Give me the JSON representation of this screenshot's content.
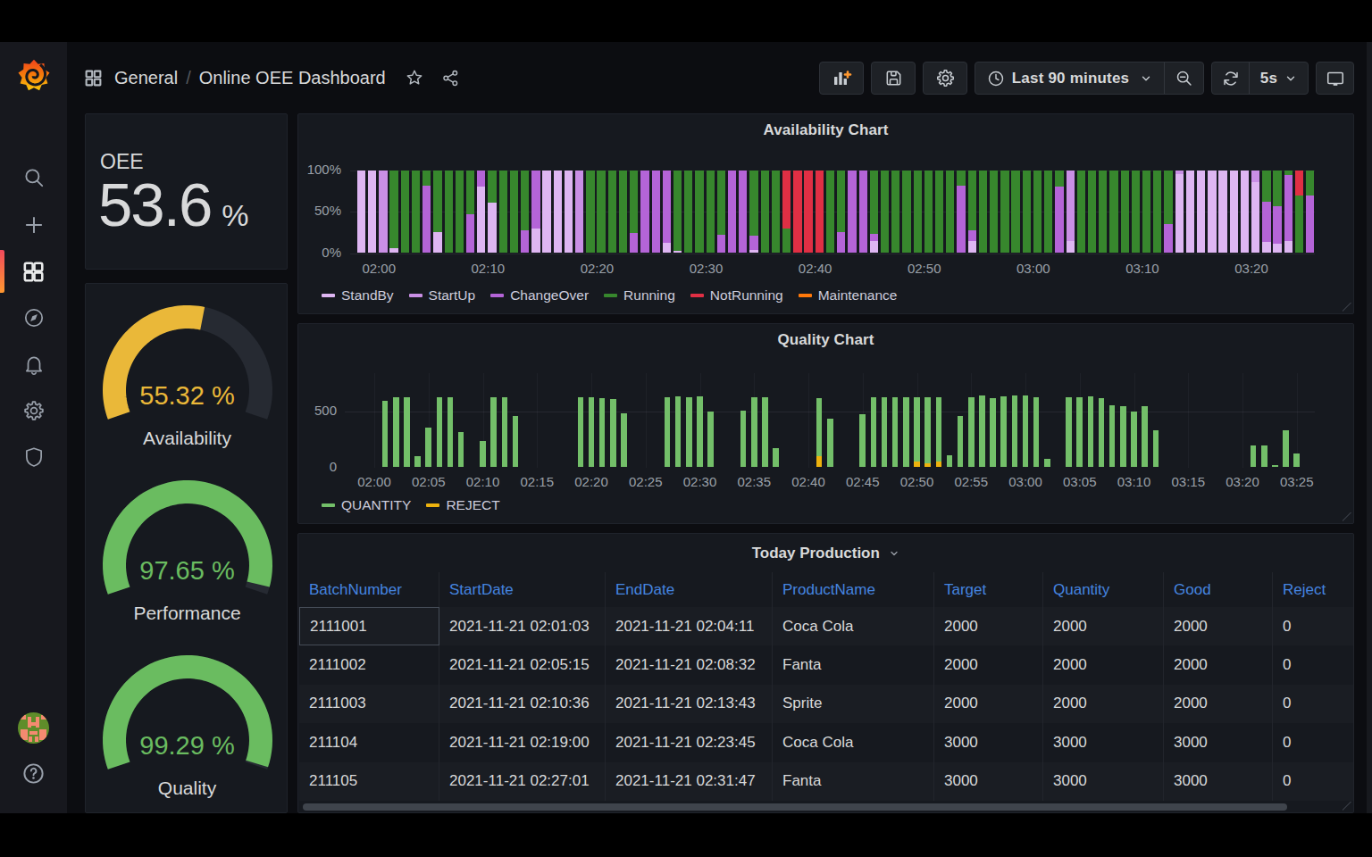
{
  "colors": {
    "standby": "#DEB6F2",
    "startup": "#C98FE5",
    "changeover": "#B464D7",
    "running": "#37872D",
    "notrunning": "#E02F44",
    "maintenance": "#FF780A",
    "quantity": "#73BF69",
    "reject": "#EDB20E",
    "gauge_yellow": "#EAB839",
    "gauge_green": "#73BF69",
    "gauge_track": "#262a32",
    "table_header_blue": "#4585e0"
  },
  "sidebar": {
    "icons": [
      "grafana-logo",
      "search",
      "plus",
      "apps",
      "compass",
      "bell",
      "gear",
      "shield"
    ],
    "avatar": "user-avatar",
    "help": "question-circle"
  },
  "header": {
    "breadcrumb_root": "General",
    "breadcrumb_sep": "/",
    "breadcrumb_current": "Online OEE Dashboard",
    "time_range_label": "Last 90 minutes",
    "refresh_interval_label": "5s"
  },
  "oee": {
    "title": "OEE",
    "value": "53.6",
    "unit": "%"
  },
  "gauges": [
    {
      "label": "Availability",
      "value_text": "55.32 %",
      "percent": 55.32,
      "color": "#EAB839"
    },
    {
      "label": "Performance",
      "value_text": "97.65 %",
      "percent": 97.65,
      "color": "#6ABC60"
    },
    {
      "label": "Quality",
      "value_text": "99.29 %",
      "percent": 99.29,
      "color": "#6ABC60"
    }
  ],
  "chart_data": [
    {
      "type": "bar",
      "title": "Availability Chart",
      "stacked": true,
      "unit": "percent",
      "ylim": [
        0,
        100
      ],
      "yticks": [
        "0%",
        "50%",
        "100%"
      ],
      "xticks": [
        "02:00",
        "02:10",
        "02:20",
        "02:30",
        "02:40",
        "02:50",
        "03:00",
        "03:10",
        "03:20"
      ],
      "legend": [
        {
          "name": "StandBy",
          "color_key": "standby"
        },
        {
          "name": "StartUp",
          "color_key": "startup"
        },
        {
          "name": "ChangeOver",
          "color_key": "changeover"
        },
        {
          "name": "Running",
          "color_key": "running"
        },
        {
          "name": "NotRunning",
          "color_key": "notrunning"
        },
        {
          "name": "Maintenance",
          "color_key": "maintenance"
        }
      ],
      "start_time": "01:58",
      "bars": [
        [
          [
            "standby",
            100
          ]
        ],
        [
          [
            "standby",
            100
          ]
        ],
        [
          [
            "startup",
            100
          ]
        ],
        [
          [
            "standby",
            6
          ],
          [
            "running",
            94
          ]
        ],
        [
          [
            "running",
            100
          ]
        ],
        [
          [
            "running",
            100
          ]
        ],
        [
          [
            "changeover",
            81
          ],
          [
            "running",
            19
          ]
        ],
        [
          [
            "standby",
            25
          ],
          [
            "running",
            75
          ]
        ],
        [
          [
            "running",
            100
          ]
        ],
        [
          [
            "running",
            100
          ]
        ],
        [
          [
            "changeover",
            47
          ],
          [
            "running",
            53
          ]
        ],
        [
          [
            "standby",
            80
          ],
          [
            "changeover",
            20
          ]
        ],
        [
          [
            "standby",
            61
          ],
          [
            "running",
            39
          ]
        ],
        [
          [
            "running",
            100
          ]
        ],
        [
          [
            "running",
            100
          ]
        ],
        [
          [
            "changeover",
            27
          ],
          [
            "running",
            73
          ]
        ],
        [
          [
            "standby",
            30
          ],
          [
            "changeover",
            70
          ]
        ],
        [
          [
            "standby",
            100
          ]
        ],
        [
          [
            "standby",
            100
          ]
        ],
        [
          [
            "standby",
            100
          ]
        ],
        [
          [
            "startup",
            100
          ]
        ],
        [
          [
            "running",
            100
          ]
        ],
        [
          [
            "running",
            100
          ]
        ],
        [
          [
            "running",
            100
          ]
        ],
        [
          [
            "running",
            100
          ]
        ],
        [
          [
            "changeover",
            24
          ],
          [
            "running",
            76
          ]
        ],
        [
          [
            "changeover",
            100
          ]
        ],
        [
          [
            "changeover",
            100
          ]
        ],
        [
          [
            "standby",
            12
          ],
          [
            "changeover",
            88
          ]
        ],
        [
          [
            "standby",
            3
          ],
          [
            "running",
            97
          ]
        ],
        [
          [
            "running",
            100
          ]
        ],
        [
          [
            "running",
            100
          ]
        ],
        [
          [
            "running",
            100
          ]
        ],
        [
          [
            "changeover",
            22
          ],
          [
            "running",
            78
          ]
        ],
        [
          [
            "changeover",
            100
          ]
        ],
        [
          [
            "changeover",
            100
          ]
        ],
        [
          [
            "standby",
            4
          ],
          [
            "changeover",
            17
          ],
          [
            "running",
            79
          ]
        ],
        [
          [
            "running",
            100
          ]
        ],
        [
          [
            "running",
            100
          ]
        ],
        [
          [
            "running",
            30
          ],
          [
            "notrunning",
            70
          ]
        ],
        [
          [
            "notrunning",
            100
          ]
        ],
        [
          [
            "notrunning",
            100
          ]
        ],
        [
          [
            "notrunning",
            100
          ]
        ],
        [
          [
            "running",
            100
          ]
        ],
        [
          [
            "changeover",
            25
          ],
          [
            "running",
            75
          ]
        ],
        [
          [
            "changeover",
            100
          ]
        ],
        [
          [
            "changeover",
            100
          ]
        ],
        [
          [
            "standby",
            15
          ],
          [
            "changeover",
            8
          ],
          [
            "running",
            77
          ]
        ],
        [
          [
            "running",
            100
          ]
        ],
        [
          [
            "running",
            100
          ]
        ],
        [
          [
            "running",
            100
          ]
        ],
        [
          [
            "running",
            100
          ]
        ],
        [
          [
            "running",
            100
          ]
        ],
        [
          [
            "running",
            100
          ]
        ],
        [
          [
            "running",
            100
          ]
        ],
        [
          [
            "changeover",
            81
          ],
          [
            "running",
            19
          ]
        ],
        [
          [
            "standby",
            15
          ],
          [
            "changeover",
            13
          ],
          [
            "running",
            72
          ]
        ],
        [
          [
            "running",
            100
          ]
        ],
        [
          [
            "running",
            100
          ]
        ],
        [
          [
            "running",
            100
          ]
        ],
        [
          [
            "running",
            100
          ]
        ],
        [
          [
            "running",
            100
          ]
        ],
        [
          [
            "running",
            100
          ]
        ],
        [
          [
            "running",
            100
          ]
        ],
        [
          [
            "changeover",
            80
          ],
          [
            "running",
            20
          ]
        ],
        [
          [
            "standby",
            15
          ],
          [
            "startup",
            85
          ]
        ],
        [
          [
            "running",
            100
          ]
        ],
        [
          [
            "running",
            100
          ]
        ],
        [
          [
            "running",
            100
          ]
        ],
        [
          [
            "running",
            100
          ]
        ],
        [
          [
            "running",
            100
          ]
        ],
        [
          [
            "running",
            100
          ]
        ],
        [
          [
            "running",
            100
          ]
        ],
        [
          [
            "running",
            100
          ]
        ],
        [
          [
            "changeover",
            35
          ],
          [
            "running",
            65
          ]
        ],
        [
          [
            "standby",
            96
          ],
          [
            "startup",
            4
          ]
        ],
        [
          [
            "standby",
            100
          ]
        ],
        [
          [
            "standby",
            100
          ]
        ],
        [
          [
            "standby",
            100
          ]
        ],
        [
          [
            "standby",
            100
          ]
        ],
        [
          [
            "standby",
            100
          ]
        ],
        [
          [
            "standby",
            100
          ]
        ],
        [
          [
            "standby",
            86
          ],
          [
            "startup",
            14
          ]
        ],
        [
          [
            "standby",
            13
          ],
          [
            "changeover",
            49
          ],
          [
            "running",
            38
          ]
        ],
        [
          [
            "standby",
            11
          ],
          [
            "changeover",
            46
          ],
          [
            "running",
            43
          ]
        ],
        [
          [
            "standby",
            15
          ],
          [
            "changeover",
            79
          ],
          [
            "running",
            6
          ]
        ],
        [
          [
            "running",
            70
          ],
          [
            "notrunning",
            30
          ]
        ],
        [
          [
            "changeover",
            70
          ],
          [
            "running",
            30
          ]
        ]
      ]
    },
    {
      "type": "bar",
      "title": "Quality Chart",
      "stacked": true,
      "ylim": [
        0,
        715
      ],
      "yticks": [
        "0",
        "500"
      ],
      "xticks": [
        "02:00",
        "02:05",
        "02:10",
        "02:15",
        "02:20",
        "02:25",
        "02:30",
        "02:35",
        "02:40",
        "02:45",
        "02:50",
        "02:55",
        "03:00",
        "03:05",
        "03:10",
        "03:15",
        "03:20",
        "03:25"
      ],
      "legend": [
        {
          "name": "QUANTITY",
          "color_key": "quantity"
        },
        {
          "name": "REJECT",
          "color_key": "reject"
        }
      ],
      "bars": [
        {
          "m": 1,
          "quantity": 600,
          "reject": 0
        },
        {
          "m": 2,
          "quantity": 635,
          "reject": 0
        },
        {
          "m": 3,
          "quantity": 630,
          "reject": 0
        },
        {
          "m": 4,
          "quantity": 100,
          "reject": 0
        },
        {
          "m": 5,
          "quantity": 360,
          "reject": 0
        },
        {
          "m": 6,
          "quantity": 635,
          "reject": 0
        },
        {
          "m": 7,
          "quantity": 635,
          "reject": 0
        },
        {
          "m": 8,
          "quantity": 320,
          "reject": 0
        },
        {
          "m": 10,
          "quantity": 240,
          "reject": 0
        },
        {
          "m": 11,
          "quantity": 635,
          "reject": 0
        },
        {
          "m": 12,
          "quantity": 632,
          "reject": 0
        },
        {
          "m": 13,
          "quantity": 460,
          "reject": 0
        },
        {
          "m": 19,
          "quantity": 630,
          "reject": 0
        },
        {
          "m": 20,
          "quantity": 635,
          "reject": 0
        },
        {
          "m": 21,
          "quantity": 620,
          "reject": 0
        },
        {
          "m": 22,
          "quantity": 615,
          "reject": 0
        },
        {
          "m": 23,
          "quantity": 490,
          "reject": 0
        },
        {
          "m": 27,
          "quantity": 630,
          "reject": 0
        },
        {
          "m": 28,
          "quantity": 640,
          "reject": 0
        },
        {
          "m": 29,
          "quantity": 630,
          "reject": 0
        },
        {
          "m": 30,
          "quantity": 640,
          "reject": 0
        },
        {
          "m": 31,
          "quantity": 500,
          "reject": 0
        },
        {
          "m": 34,
          "quantity": 510,
          "reject": 0
        },
        {
          "m": 35,
          "quantity": 630,
          "reject": 0
        },
        {
          "m": 36,
          "quantity": 635,
          "reject": 0
        },
        {
          "m": 37,
          "quantity": 170,
          "reject": 0
        },
        {
          "m": 41,
          "quantity": 520,
          "reject": 100
        },
        {
          "m": 42,
          "quantity": 440,
          "reject": 0
        },
        {
          "m": 45,
          "quantity": 480,
          "reject": 0
        },
        {
          "m": 46,
          "quantity": 630,
          "reject": 0
        },
        {
          "m": 47,
          "quantity": 630,
          "reject": 0
        },
        {
          "m": 48,
          "quantity": 630,
          "reject": 0
        },
        {
          "m": 49,
          "quantity": 630,
          "reject": 0
        },
        {
          "m": 50,
          "quantity": 580,
          "reject": 50
        },
        {
          "m": 51,
          "quantity": 590,
          "reject": 40
        },
        {
          "m": 52,
          "quantity": 580,
          "reject": 50
        },
        {
          "m": 53,
          "quantity": 105,
          "reject": 0
        },
        {
          "m": 54,
          "quantity": 460,
          "reject": 0
        },
        {
          "m": 55,
          "quantity": 630,
          "reject": 0
        },
        {
          "m": 56,
          "quantity": 645,
          "reject": 0
        },
        {
          "m": 57,
          "quantity": 628,
          "reject": 0
        },
        {
          "m": 58,
          "quantity": 640,
          "reject": 0
        },
        {
          "m": 59,
          "quantity": 645,
          "reject": 0
        },
        {
          "m": 60,
          "quantity": 648,
          "reject": 0
        },
        {
          "m": 61,
          "quantity": 630,
          "reject": 0
        },
        {
          "m": 62,
          "quantity": 75,
          "reject": 0
        },
        {
          "m": 64,
          "quantity": 630,
          "reject": 0
        },
        {
          "m": 65,
          "quantity": 632,
          "reject": 0
        },
        {
          "m": 66,
          "quantity": 640,
          "reject": 0
        },
        {
          "m": 67,
          "quantity": 628,
          "reject": 0
        },
        {
          "m": 68,
          "quantity": 560,
          "reject": 0
        },
        {
          "m": 69,
          "quantity": 550,
          "reject": 0
        },
        {
          "m": 70,
          "quantity": 500,
          "reject": 0
        },
        {
          "m": 71,
          "quantity": 555,
          "reject": 0
        },
        {
          "m": 72,
          "quantity": 335,
          "reject": 0
        },
        {
          "m": 81,
          "quantity": 200,
          "reject": 0
        },
        {
          "m": 82,
          "quantity": 200,
          "reject": 0
        },
        {
          "m": 83,
          "quantity": 20,
          "reject": 0
        },
        {
          "m": 84,
          "quantity": 335,
          "reject": 0
        },
        {
          "m": 85,
          "quantity": 125,
          "reject": 0
        }
      ]
    },
    {
      "type": "table",
      "title": "Today Production",
      "columns": [
        "BatchNumber",
        "StartDate",
        "EndDate",
        "ProductName",
        "Target",
        "Quantity",
        "Good",
        "Reject"
      ],
      "rows": [
        [
          "2111001",
          "2021-11-21 02:01:03",
          "2021-11-21 02:04:11",
          "Coca Cola",
          "2000",
          "2000",
          "2000",
          "0"
        ],
        [
          "2111002",
          "2021-11-21 02:05:15",
          "2021-11-21 02:08:32",
          "Fanta",
          "2000",
          "2000",
          "2000",
          "0"
        ],
        [
          "2111003",
          "2021-11-21 02:10:36",
          "2021-11-21 02:13:43",
          "Sprite",
          "2000",
          "2000",
          "2000",
          "0"
        ],
        [
          "211104",
          "2021-11-21 02:19:00",
          "2021-11-21 02:23:45",
          "Coca Cola",
          "3000",
          "3000",
          "3000",
          "0"
        ],
        [
          "211105",
          "2021-11-21 02:27:01",
          "2021-11-21 02:31:47",
          "Fanta",
          "3000",
          "3000",
          "3000",
          "0"
        ]
      ]
    }
  ]
}
